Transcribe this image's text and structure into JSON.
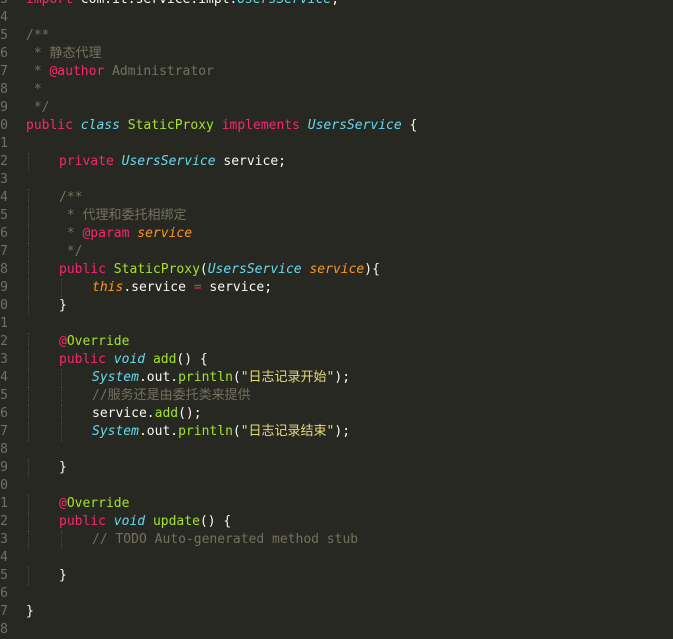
{
  "editor": {
    "lines": [
      {
        "n": "3",
        "indent": 0,
        "tokens": [
          [
            "kw",
            "import "
          ],
          [
            "pl",
            "com.it.service.impl."
          ],
          [
            "ty",
            "UsersService"
          ],
          [
            "pl",
            ";"
          ]
        ]
      },
      {
        "n": "4",
        "indent": 0,
        "tokens": []
      },
      {
        "n": "5",
        "indent": 0,
        "tokens": [
          [
            "cm",
            "/**"
          ]
        ]
      },
      {
        "n": "6",
        "indent": 0,
        "tokens": [
          [
            "cm",
            " * 静态代理"
          ]
        ]
      },
      {
        "n": "7",
        "indent": 0,
        "tokens": [
          [
            "cm",
            " * "
          ],
          [
            "tag",
            "@author"
          ],
          [
            "cm",
            " Administrator"
          ]
        ]
      },
      {
        "n": "8",
        "indent": 0,
        "tokens": [
          [
            "cm",
            " *"
          ]
        ]
      },
      {
        "n": "9",
        "indent": 0,
        "tokens": [
          [
            "cm",
            " */"
          ]
        ]
      },
      {
        "n": "0",
        "indent": 0,
        "tokens": [
          [
            "kw",
            "public "
          ],
          [
            "st",
            "class "
          ],
          [
            "cls",
            "StaticProxy "
          ],
          [
            "kw",
            "implements "
          ],
          [
            "ty",
            "UsersService"
          ],
          [
            "pl",
            " {"
          ]
        ]
      },
      {
        "n": "1",
        "indent": 0,
        "tokens": []
      },
      {
        "n": "2",
        "indent": 1,
        "tokens": [
          [
            "kw",
            "private "
          ],
          [
            "ty",
            "UsersService"
          ],
          [
            "pl",
            " service;"
          ]
        ]
      },
      {
        "n": "3",
        "indent": 0,
        "tokens": []
      },
      {
        "n": "4",
        "indent": 1,
        "tokens": [
          [
            "cm",
            "/**"
          ]
        ]
      },
      {
        "n": "5",
        "indent": 1,
        "tokens": [
          [
            "cm",
            " * 代理和委托相绑定"
          ]
        ]
      },
      {
        "n": "6",
        "indent": 1,
        "tokens": [
          [
            "cm",
            " * "
          ],
          [
            "tag",
            "@param"
          ],
          [
            "cm",
            " "
          ],
          [
            "par",
            "service"
          ]
        ]
      },
      {
        "n": "7",
        "indent": 1,
        "tokens": [
          [
            "cm",
            " */"
          ]
        ]
      },
      {
        "n": "8",
        "indent": 1,
        "tokens": [
          [
            "kw",
            "public "
          ],
          [
            "fn",
            "StaticProxy"
          ],
          [
            "pl",
            "("
          ],
          [
            "ty",
            "UsersService"
          ],
          [
            "pl",
            " "
          ],
          [
            "par",
            "service"
          ],
          [
            "pl",
            "){"
          ]
        ]
      },
      {
        "n": "9",
        "indent": 2,
        "tokens": [
          [
            "th",
            "this"
          ],
          [
            "pl",
            ".service "
          ],
          [
            "kw",
            "="
          ],
          [
            "pl",
            " service;"
          ]
        ]
      },
      {
        "n": "0",
        "indent": 1,
        "tokens": [
          [
            "pl",
            "}"
          ]
        ]
      },
      {
        "n": "1",
        "indent": 0,
        "tokens": []
      },
      {
        "n": "2",
        "indent": 1,
        "tokens": [
          [
            "kw",
            "@"
          ],
          [
            "ann",
            "Override"
          ]
        ]
      },
      {
        "n": "3",
        "indent": 1,
        "tokens": [
          [
            "kw",
            "public "
          ],
          [
            "st",
            "void "
          ],
          [
            "fn",
            "add"
          ],
          [
            "pl",
            "() {"
          ]
        ]
      },
      {
        "n": "4",
        "indent": 2,
        "tokens": [
          [
            "ty",
            "System"
          ],
          [
            "pl",
            ".out."
          ],
          [
            "fn",
            "println"
          ],
          [
            "pl",
            "("
          ],
          [
            "str",
            "\"日志记录开始\""
          ],
          [
            "pl",
            ");"
          ]
        ]
      },
      {
        "n": "5",
        "indent": 2,
        "tokens": [
          [
            "cm",
            "//服务还是由委托类来提供"
          ]
        ]
      },
      {
        "n": "6",
        "indent": 2,
        "tokens": [
          [
            "pl",
            "service."
          ],
          [
            "fn",
            "add"
          ],
          [
            "pl",
            "();"
          ]
        ]
      },
      {
        "n": "7",
        "indent": 2,
        "tokens": [
          [
            "ty",
            "System"
          ],
          [
            "pl",
            ".out."
          ],
          [
            "fn",
            "println"
          ],
          [
            "pl",
            "("
          ],
          [
            "str",
            "\"日志记录结束\""
          ],
          [
            "pl",
            ");"
          ]
        ]
      },
      {
        "n": "8",
        "indent": 0,
        "tokens": []
      },
      {
        "n": "9",
        "indent": 1,
        "tokens": [
          [
            "pl",
            "}"
          ]
        ]
      },
      {
        "n": "0",
        "indent": 0,
        "tokens": []
      },
      {
        "n": "1",
        "indent": 1,
        "tokens": [
          [
            "kw",
            "@"
          ],
          [
            "ann",
            "Override"
          ]
        ]
      },
      {
        "n": "2",
        "indent": 1,
        "tokens": [
          [
            "kw",
            "public "
          ],
          [
            "st",
            "void "
          ],
          [
            "fn",
            "update"
          ],
          [
            "pl",
            "() {"
          ]
        ]
      },
      {
        "n": "3",
        "indent": 2,
        "tokens": [
          [
            "cm",
            "// TODO Auto-generated method stub"
          ]
        ]
      },
      {
        "n": "4",
        "indent": 0,
        "tokens": []
      },
      {
        "n": "5",
        "indent": 1,
        "tokens": [
          [
            "pl",
            "}"
          ]
        ]
      },
      {
        "n": "6",
        "indent": 0,
        "tokens": []
      },
      {
        "n": "7",
        "indent": 0,
        "tokens": [
          [
            "pl",
            "}"
          ]
        ]
      },
      {
        "n": "8",
        "indent": 0,
        "tokens": []
      }
    ]
  },
  "colors": {
    "background": "#272822",
    "keyword": "#f92672",
    "type": "#66d9ef",
    "function": "#a6e22e",
    "parameter": "#fd971f",
    "string": "#e6db74",
    "comment": "#75715e",
    "text": "#f8f8f2"
  }
}
